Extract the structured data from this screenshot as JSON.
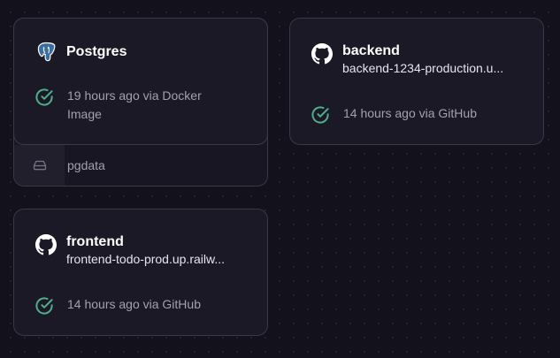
{
  "services": {
    "postgres": {
      "name": "Postgres",
      "icon": "postgres-elephant-icon",
      "status_text": "19 hours ago via Docker Image",
      "status_icon": "check-circle-icon",
      "volume": {
        "icon": "hard-drive-icon",
        "name": "pgdata"
      }
    },
    "backend": {
      "name": "backend",
      "icon": "github-icon",
      "url": "backend-1234-production.u...",
      "status_text": "14 hours ago via GitHub",
      "status_icon": "check-circle-icon"
    },
    "frontend": {
      "name": "frontend",
      "icon": "github-icon",
      "url": "frontend-todo-prod.up.railw...",
      "status_text": "14 hours ago via GitHub",
      "status_icon": "check-circle-icon"
    }
  },
  "colors": {
    "background": "#13111c",
    "card": "#1b1925",
    "border": "#3b3849",
    "success": "#4fae8c",
    "muted_text": "#a3a0b0"
  }
}
